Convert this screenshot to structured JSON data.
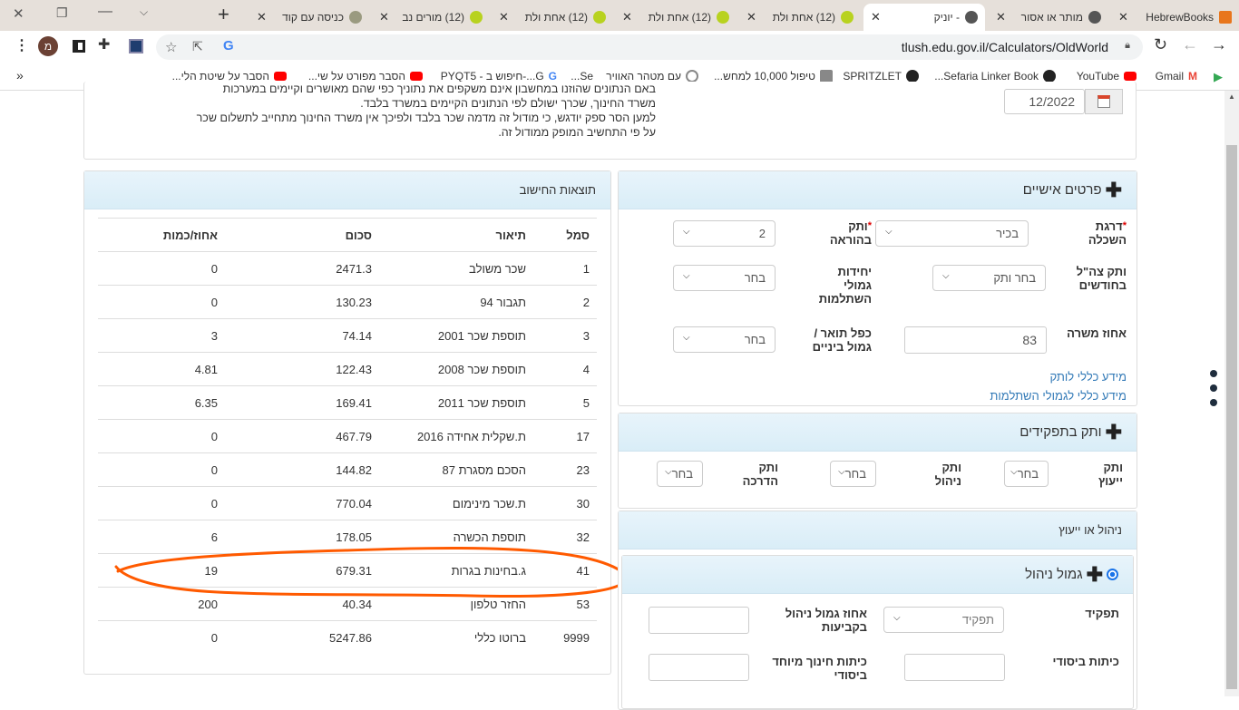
{
  "browser": {
    "tabs": [
      {
        "label": "HebrewBooks",
        "icon": "hebrewbooks-icon"
      },
      {
        "label": "מותר או אסור",
        "icon": "globe-icon"
      },
      {
        "label": "- יוניק",
        "icon": "globe-icon",
        "active": true
      },
      {
        "label": "(12) אחת ולת",
        "icon": "whatsapp-icon"
      },
      {
        "label": "(12) אחת ולת",
        "icon": "whatsapp-icon"
      },
      {
        "label": "(12) אחת ולת",
        "icon": "whatsapp-icon"
      },
      {
        "label": "(12) מורים נב",
        "icon": "whatsapp-icon"
      },
      {
        "label": "כניסה עם קוד",
        "icon": "owl-icon"
      }
    ],
    "close_glyph": "✕",
    "new_tab": "+",
    "url": "tlush.edu.gov.il/Calculators/OldWorld",
    "profile_initial": "מ",
    "bookmarks": [
      "Gmail",
      "YouTube",
      "Sefaria Linker Book...",
      "SPRITZLET",
      "טיפול 10,000 למחש...",
      "עם מטהר האוויר",
      "Se...",
      "G...-חיפוש ב - PYQT5",
      "הסבר מפורט על שי...",
      "הסבר על שיטת הלי..."
    ],
    "bookmarks_overflow": "»"
  },
  "disclaimer": {
    "lines": [
      "באם הנתונים שהוזנו במחשבון אינם משקפים את נתוניך כפי שהם מאושרים וקיימים במערכות",
      "משרד החינוך, שכרך ישולם לפי הנתונים הקיימים במשרד בלבד.",
      "למען הסר ספק יודגש, כי מודול זה מדמה שכר בלבד ולפיכך אין משרד החינוך מתחייב לתשלום שכר",
      "על פי התחשיב המופק ממודול זה."
    ],
    "date": "12/2022"
  },
  "results": {
    "title": "תוצאות החישוב",
    "headers": [
      "סמל",
      "תיאור",
      "סכום",
      "אחוז/כמות"
    ],
    "rows": [
      [
        "1",
        "שכר משולב",
        "2471.3",
        "0"
      ],
      [
        "2",
        "תגבור 94",
        "130.23",
        "0"
      ],
      [
        "3",
        "תוספת שכר 2001",
        "74.14",
        "3"
      ],
      [
        "4",
        "תוספת שכר 2008",
        "122.43",
        "4.81"
      ],
      [
        "5",
        "תוספת שכר 2011",
        "169.41",
        "6.35"
      ],
      [
        "17",
        "ת.שקלית אחידה 2016",
        "467.79",
        "0"
      ],
      [
        "23",
        "הסכם מסגרת 87",
        "144.82",
        "0"
      ],
      [
        "30",
        "ת.שכר מינימום",
        "770.04",
        "0"
      ],
      [
        "32",
        "תוספת הכשרה",
        "178.05",
        "6"
      ],
      [
        "41",
        "ג.בחינות בגרות",
        "679.31",
        "19"
      ],
      [
        "53",
        "החזר טלפון",
        "40.34",
        "200"
      ],
      [
        "9999",
        "ברוטו כללי",
        "5247.86",
        "0"
      ]
    ],
    "highlighted_row": "41",
    "annotation_color": "#ff5a00"
  },
  "personal": {
    "title": "פרטים אישיים",
    "education_label": "דרגת השכלה",
    "education_value": "בכיר",
    "teaching_label": "ותק בהוראה",
    "teaching_value": "2",
    "army_label": "ותק צה\"ל בחודשים",
    "army_value": "בחר ותק",
    "units_label": "יחידות גמולי השתלמות",
    "units_value": "בחר",
    "job_pct_label": "אחוז משרה",
    "job_pct_value": "83",
    "degree_label": "כפל תואר / גמול ביניים",
    "degree_value": "בחר",
    "link1": "מידע כללי לותק",
    "link2": "מידע כללי לגמולי השתלמות",
    "required": "*"
  },
  "roles": {
    "title": "ותק בתפקידים",
    "advice_label": "ותק ייעוץ",
    "advice_value": "בחר",
    "mgmt_label": "ותק ניהול",
    "mgmt_value": "בחר",
    "guide_label": "ותק הדרכה",
    "guide_value": "בחר"
  },
  "mgmt": {
    "title": "ניהול או ייעוץ",
    "sub_title": "גמול ניהול",
    "role_label": "תפקיד",
    "role_value": "תפקיד",
    "pct_label": "אחוז גמול ניהול בקביעות",
    "classes_label": "כיתות ביסודי",
    "special_label": "כיתות חינוך מיוחד ביסודי"
  }
}
